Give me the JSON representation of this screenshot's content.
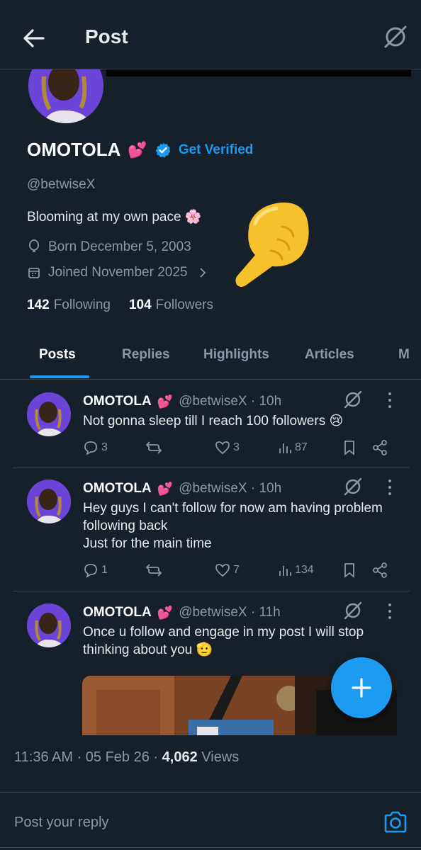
{
  "header": {
    "title": "Post",
    "back_icon": "arrow-left-icon",
    "grok_icon": "grok-icon"
  },
  "profile": {
    "name": "OMOTOLA",
    "name_emoji": "💕",
    "get_verified": "Get Verified",
    "handle": "@betwiseX",
    "bio": "Blooming at my own pace 🌸",
    "born": "Born December 5, 2003",
    "joined": "Joined November 2025",
    "following_count": "142",
    "following_label": "Following",
    "followers_count": "104",
    "followers_label": "Followers"
  },
  "tabs": [
    "Posts",
    "Replies",
    "Highlights",
    "Articles",
    "M"
  ],
  "tweets": [
    {
      "name": "OMOTOLA",
      "emoji": "💕",
      "handle_time": "@betwiseX · 10h",
      "text": "Not gonna sleep till I reach 100 followers 😢",
      "replies": "3",
      "likes": "3",
      "views": "87"
    },
    {
      "name": "OMOTOLA",
      "emoji": "💕",
      "handle_time": "@betwiseX · 10h",
      "text": "Hey guys I can't follow for now am having problem following back\nJust for the main time",
      "replies": "1",
      "likes": "7",
      "views": "134"
    },
    {
      "name": "OMOTOLA",
      "emoji": "💕",
      "handle_time": "@betwiseX · 11h",
      "text": "Once u follow and engage in my post I will stop thinking about you 🫡"
    }
  ],
  "post_meta": {
    "time_date": "11:36 AM · 05 Feb 26 · ",
    "views_count": "4,062",
    "views_label": "Views"
  },
  "reply": {
    "placeholder": "Post your reply"
  },
  "colors": {
    "background": "#15202b",
    "accent": "#1d9bf0",
    "muted": "#8b98a5",
    "border": "#38444d"
  }
}
